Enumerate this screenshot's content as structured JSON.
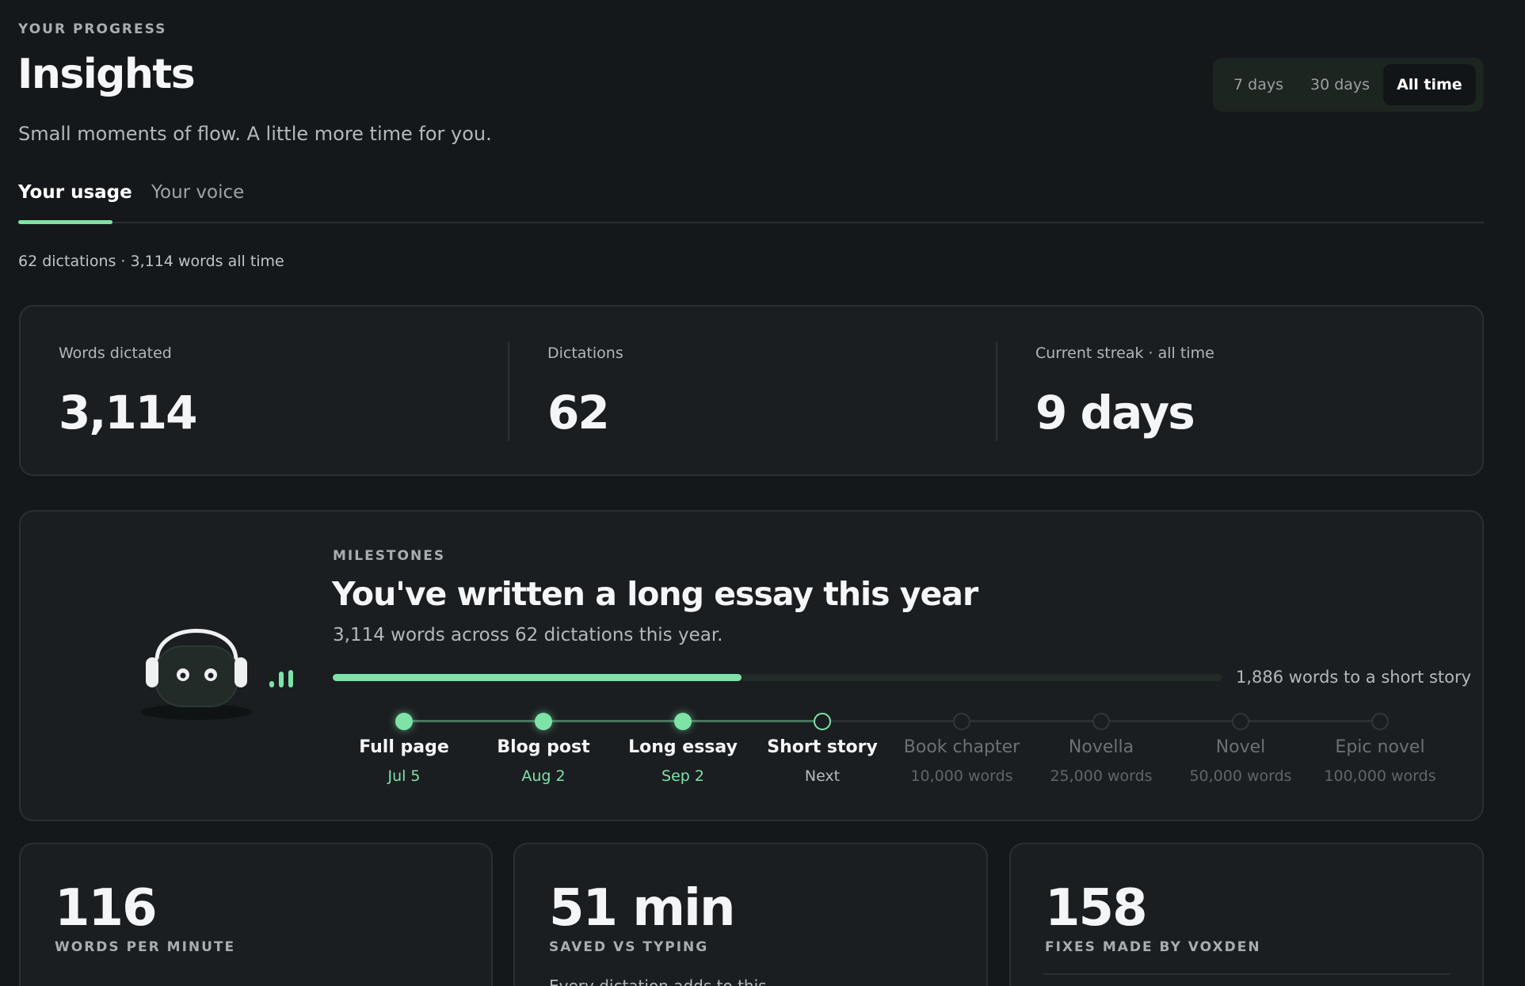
{
  "header": {
    "eyebrow": "YOUR PROGRESS",
    "title": "Insights",
    "subtitle": "Small moments of flow. A little more time for you."
  },
  "range": {
    "options": [
      "7 days",
      "30 days",
      "All time"
    ],
    "selected": "All time"
  },
  "tabs": {
    "items": [
      "Your usage",
      "Your voice"
    ],
    "active": "Your usage"
  },
  "summary": "62 dictations · 3,114 words all time",
  "stats": [
    {
      "label": "Words dictated",
      "value": "3,114"
    },
    {
      "label": "Dictations",
      "value": "62"
    },
    {
      "label": "Current streak · all time",
      "value": "9 days"
    }
  ],
  "milestones": {
    "eyebrow": "MILESTONES",
    "title": "You've written a long essay this year",
    "subtitle": "3,114 words across 62 dictations this year.",
    "progress_fraction": 0.46,
    "progress_note": "1,886 words to a short story",
    "items": [
      {
        "name": "Full page",
        "sub": "Jul 5",
        "state": "done"
      },
      {
        "name": "Blog post",
        "sub": "Aug 2",
        "state": "done"
      },
      {
        "name": "Long essay",
        "sub": "Sep 2",
        "state": "done"
      },
      {
        "name": "Short story",
        "sub": "Next",
        "state": "next"
      },
      {
        "name": "Book chapter",
        "sub": "10,000 words",
        "state": "future"
      },
      {
        "name": "Novella",
        "sub": "25,000 words",
        "state": "future"
      },
      {
        "name": "Novel",
        "sub": "50,000 words",
        "state": "future"
      },
      {
        "name": "Epic novel",
        "sub": "100,000 words",
        "state": "future"
      }
    ]
  },
  "metrics": [
    {
      "value": "116",
      "label": "WORDS PER MINUTE",
      "extra": ""
    },
    {
      "value": "51 min",
      "label": "SAVED VS TYPING",
      "extra": "Every dictation adds to this"
    },
    {
      "value": "158",
      "label": "FIXES MADE BY VOXDEN",
      "extra": ""
    }
  ],
  "colors": {
    "accent": "#7ee3a6",
    "background": "#15181b",
    "card": "#1b1e21"
  }
}
